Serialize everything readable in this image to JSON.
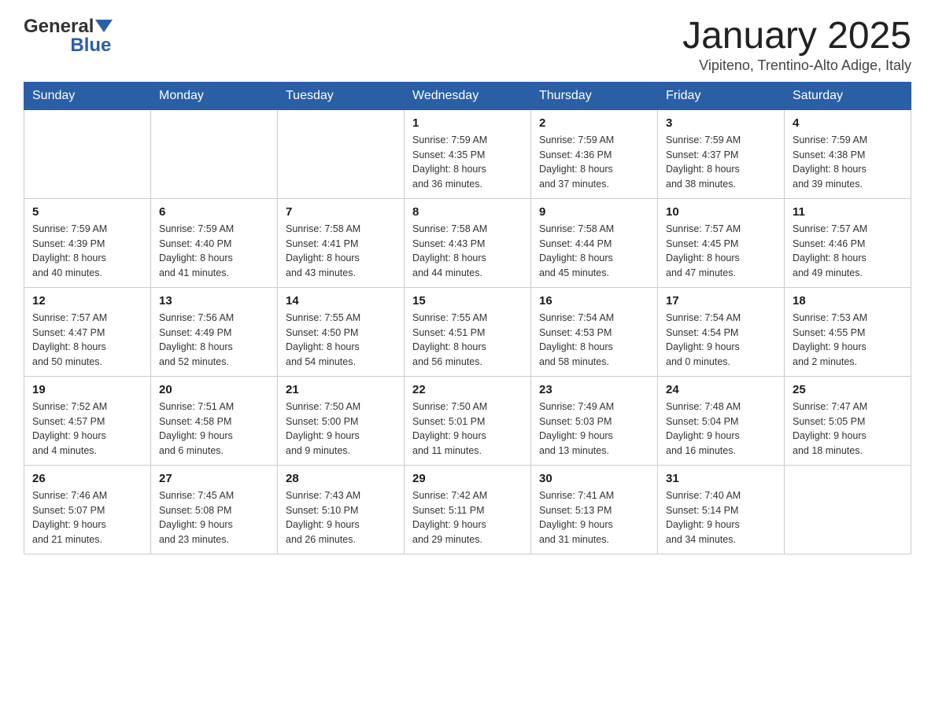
{
  "header": {
    "logo": {
      "general": "General",
      "arrow": "▼",
      "blue": "Blue"
    },
    "title": "January 2025",
    "subtitle": "Vipiteno, Trentino-Alto Adige, Italy"
  },
  "days_of_week": [
    "Sunday",
    "Monday",
    "Tuesday",
    "Wednesday",
    "Thursday",
    "Friday",
    "Saturday"
  ],
  "weeks": [
    [
      {
        "day": "",
        "info": ""
      },
      {
        "day": "",
        "info": ""
      },
      {
        "day": "",
        "info": ""
      },
      {
        "day": "1",
        "info": "Sunrise: 7:59 AM\nSunset: 4:35 PM\nDaylight: 8 hours\nand 36 minutes."
      },
      {
        "day": "2",
        "info": "Sunrise: 7:59 AM\nSunset: 4:36 PM\nDaylight: 8 hours\nand 37 minutes."
      },
      {
        "day": "3",
        "info": "Sunrise: 7:59 AM\nSunset: 4:37 PM\nDaylight: 8 hours\nand 38 minutes."
      },
      {
        "day": "4",
        "info": "Sunrise: 7:59 AM\nSunset: 4:38 PM\nDaylight: 8 hours\nand 39 minutes."
      }
    ],
    [
      {
        "day": "5",
        "info": "Sunrise: 7:59 AM\nSunset: 4:39 PM\nDaylight: 8 hours\nand 40 minutes."
      },
      {
        "day": "6",
        "info": "Sunrise: 7:59 AM\nSunset: 4:40 PM\nDaylight: 8 hours\nand 41 minutes."
      },
      {
        "day": "7",
        "info": "Sunrise: 7:58 AM\nSunset: 4:41 PM\nDaylight: 8 hours\nand 43 minutes."
      },
      {
        "day": "8",
        "info": "Sunrise: 7:58 AM\nSunset: 4:43 PM\nDaylight: 8 hours\nand 44 minutes."
      },
      {
        "day": "9",
        "info": "Sunrise: 7:58 AM\nSunset: 4:44 PM\nDaylight: 8 hours\nand 45 minutes."
      },
      {
        "day": "10",
        "info": "Sunrise: 7:57 AM\nSunset: 4:45 PM\nDaylight: 8 hours\nand 47 minutes."
      },
      {
        "day": "11",
        "info": "Sunrise: 7:57 AM\nSunset: 4:46 PM\nDaylight: 8 hours\nand 49 minutes."
      }
    ],
    [
      {
        "day": "12",
        "info": "Sunrise: 7:57 AM\nSunset: 4:47 PM\nDaylight: 8 hours\nand 50 minutes."
      },
      {
        "day": "13",
        "info": "Sunrise: 7:56 AM\nSunset: 4:49 PM\nDaylight: 8 hours\nand 52 minutes."
      },
      {
        "day": "14",
        "info": "Sunrise: 7:55 AM\nSunset: 4:50 PM\nDaylight: 8 hours\nand 54 minutes."
      },
      {
        "day": "15",
        "info": "Sunrise: 7:55 AM\nSunset: 4:51 PM\nDaylight: 8 hours\nand 56 minutes."
      },
      {
        "day": "16",
        "info": "Sunrise: 7:54 AM\nSunset: 4:53 PM\nDaylight: 8 hours\nand 58 minutes."
      },
      {
        "day": "17",
        "info": "Sunrise: 7:54 AM\nSunset: 4:54 PM\nDaylight: 9 hours\nand 0 minutes."
      },
      {
        "day": "18",
        "info": "Sunrise: 7:53 AM\nSunset: 4:55 PM\nDaylight: 9 hours\nand 2 minutes."
      }
    ],
    [
      {
        "day": "19",
        "info": "Sunrise: 7:52 AM\nSunset: 4:57 PM\nDaylight: 9 hours\nand 4 minutes."
      },
      {
        "day": "20",
        "info": "Sunrise: 7:51 AM\nSunset: 4:58 PM\nDaylight: 9 hours\nand 6 minutes."
      },
      {
        "day": "21",
        "info": "Sunrise: 7:50 AM\nSunset: 5:00 PM\nDaylight: 9 hours\nand 9 minutes."
      },
      {
        "day": "22",
        "info": "Sunrise: 7:50 AM\nSunset: 5:01 PM\nDaylight: 9 hours\nand 11 minutes."
      },
      {
        "day": "23",
        "info": "Sunrise: 7:49 AM\nSunset: 5:03 PM\nDaylight: 9 hours\nand 13 minutes."
      },
      {
        "day": "24",
        "info": "Sunrise: 7:48 AM\nSunset: 5:04 PM\nDaylight: 9 hours\nand 16 minutes."
      },
      {
        "day": "25",
        "info": "Sunrise: 7:47 AM\nSunset: 5:05 PM\nDaylight: 9 hours\nand 18 minutes."
      }
    ],
    [
      {
        "day": "26",
        "info": "Sunrise: 7:46 AM\nSunset: 5:07 PM\nDaylight: 9 hours\nand 21 minutes."
      },
      {
        "day": "27",
        "info": "Sunrise: 7:45 AM\nSunset: 5:08 PM\nDaylight: 9 hours\nand 23 minutes."
      },
      {
        "day": "28",
        "info": "Sunrise: 7:43 AM\nSunset: 5:10 PM\nDaylight: 9 hours\nand 26 minutes."
      },
      {
        "day": "29",
        "info": "Sunrise: 7:42 AM\nSunset: 5:11 PM\nDaylight: 9 hours\nand 29 minutes."
      },
      {
        "day": "30",
        "info": "Sunrise: 7:41 AM\nSunset: 5:13 PM\nDaylight: 9 hours\nand 31 minutes."
      },
      {
        "day": "31",
        "info": "Sunrise: 7:40 AM\nSunset: 5:14 PM\nDaylight: 9 hours\nand 34 minutes."
      },
      {
        "day": "",
        "info": ""
      }
    ]
  ]
}
